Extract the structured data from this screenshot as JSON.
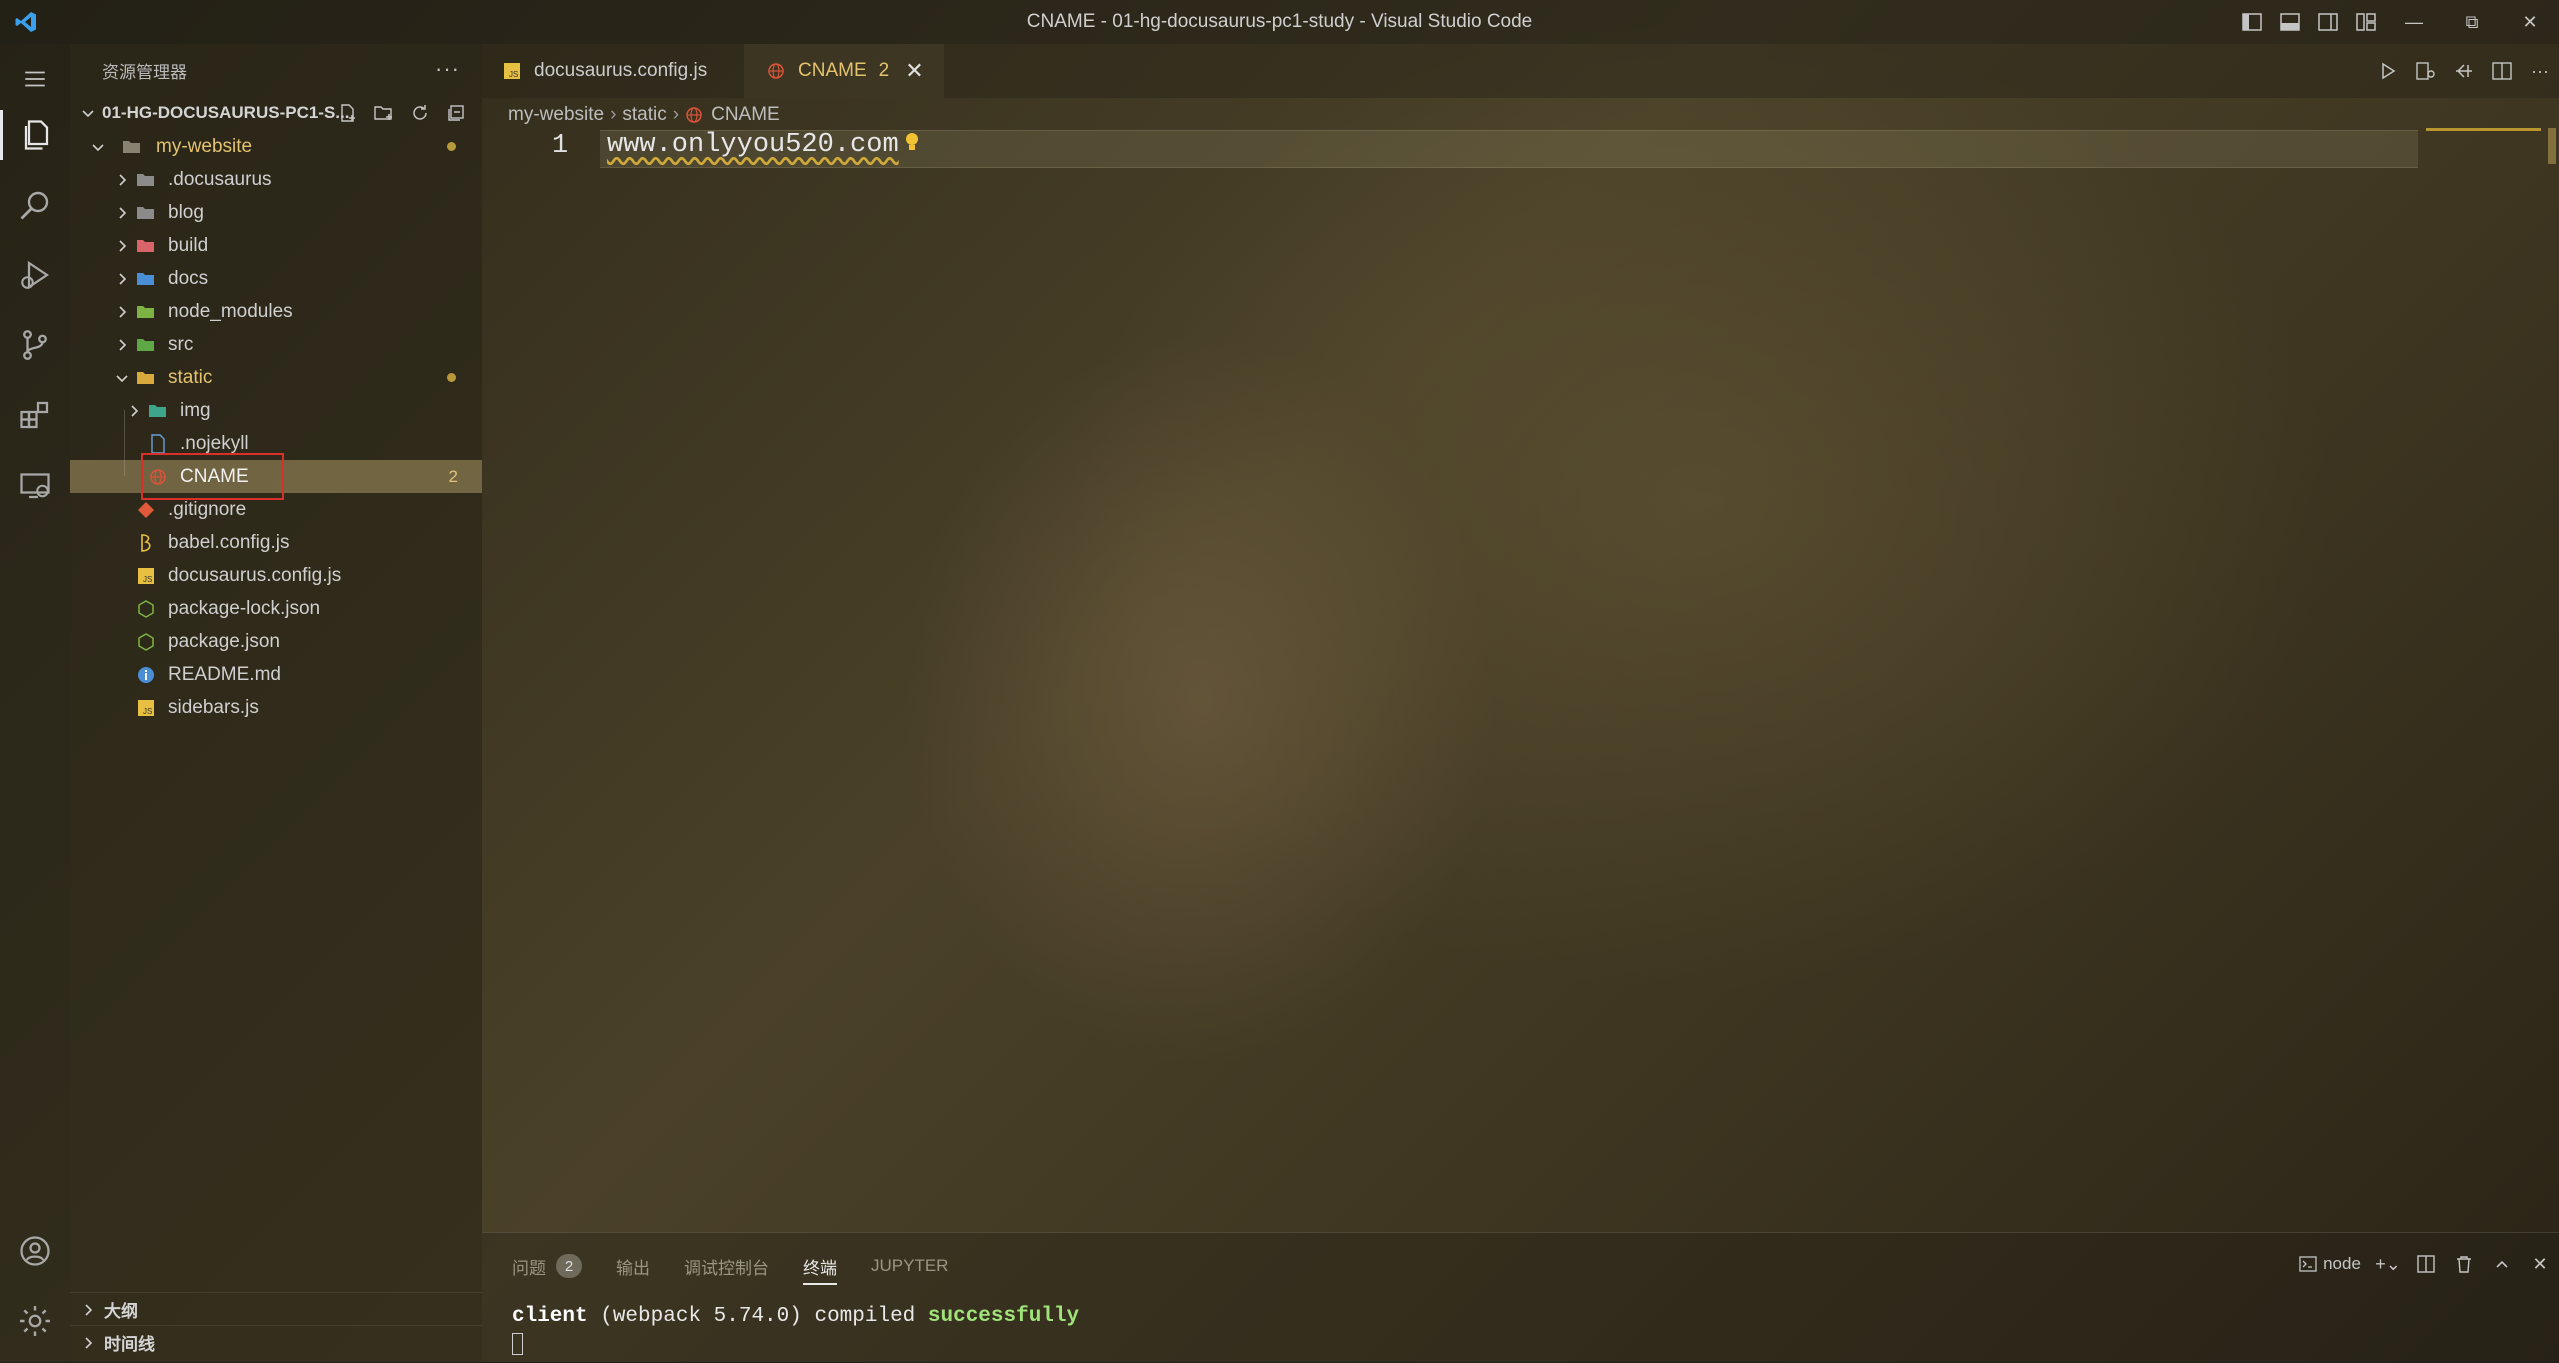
{
  "window": {
    "title": "CNAME - 01-hg-docusaurus-pc1-study - Visual Studio Code"
  },
  "activity_bar": {
    "items": [
      "explorer-icon",
      "search-icon",
      "run-debug-icon",
      "source-control-icon",
      "extensions-icon",
      "remote-explorer-icon"
    ],
    "bottom": [
      "account-icon",
      "settings-gear-icon"
    ]
  },
  "sidebar": {
    "header": "资源管理器",
    "more": "···",
    "project": "01-HG-DOCUSAURUS-PC1-S...",
    "tree": [
      {
        "label": "my-website",
        "type": "folder-open",
        "modified": true
      },
      {
        "label": ".docusaurus",
        "type": "folder"
      },
      {
        "label": "blog",
        "type": "folder"
      },
      {
        "label": "build",
        "type": "folder"
      },
      {
        "label": "docs",
        "type": "folder"
      },
      {
        "label": "node_modules",
        "type": "folder"
      },
      {
        "label": "src",
        "type": "folder"
      },
      {
        "label": "static",
        "type": "folder-open",
        "modified": true
      },
      {
        "label": "img",
        "type": "folder"
      },
      {
        "label": ".nojekyll",
        "type": "file"
      },
      {
        "label": "CNAME",
        "type": "file",
        "selected": true,
        "problems": "2"
      },
      {
        "label": ".gitignore",
        "type": "file"
      },
      {
        "label": "babel.config.js",
        "type": "file"
      },
      {
        "label": "docusaurus.config.js",
        "type": "file"
      },
      {
        "label": "package-lock.json",
        "type": "file"
      },
      {
        "label": "package.json",
        "type": "file"
      },
      {
        "label": "README.md",
        "type": "file"
      },
      {
        "label": "sidebars.js",
        "type": "file"
      }
    ],
    "footer": {
      "outline": "大纲",
      "timeline": "时间线"
    }
  },
  "editor": {
    "tabs": [
      {
        "label": "docusaurus.config.js",
        "active": false
      },
      {
        "label": "CNAME",
        "active": true,
        "badge": "2"
      }
    ],
    "breadcrumb": [
      "my-website",
      "static",
      "CNAME"
    ],
    "line_number": "1",
    "code": "www.onlyyou520.com"
  },
  "panel": {
    "tabs": [
      {
        "label": "问题",
        "badge": "2"
      },
      {
        "label": "输出"
      },
      {
        "label": "调试控制台"
      },
      {
        "label": "终端",
        "active": true
      },
      {
        "label": "JUPYTER"
      }
    ],
    "terminal_name": "node",
    "terminal": {
      "prefix": "client",
      "middle": " (webpack 5.74.0) compiled ",
      "status": "successfully"
    }
  },
  "colors": {
    "accent": "#e5c36d",
    "highlight_box": "#d9302a",
    "success": "#9fe37a"
  }
}
